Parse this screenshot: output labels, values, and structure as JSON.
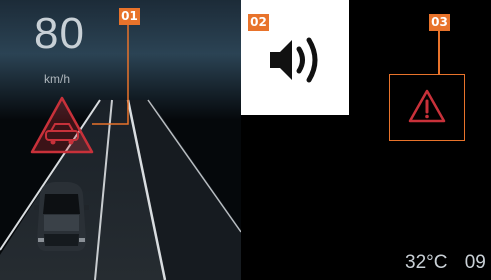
{
  "speed": {
    "value": "80",
    "unit": "km/h"
  },
  "callouts": {
    "one": "01",
    "two": "02",
    "three": "03"
  },
  "status": {
    "temperature": "32°C",
    "clock_partial": "09"
  },
  "icons": {
    "collision": "car-collision-warning-icon",
    "speaker": "speaker-sound-icon",
    "alert": "warning-triangle-icon"
  },
  "colors": {
    "callout": "#e8732b",
    "alert_red": "#c8313a",
    "road_line": "#d9dde0"
  }
}
